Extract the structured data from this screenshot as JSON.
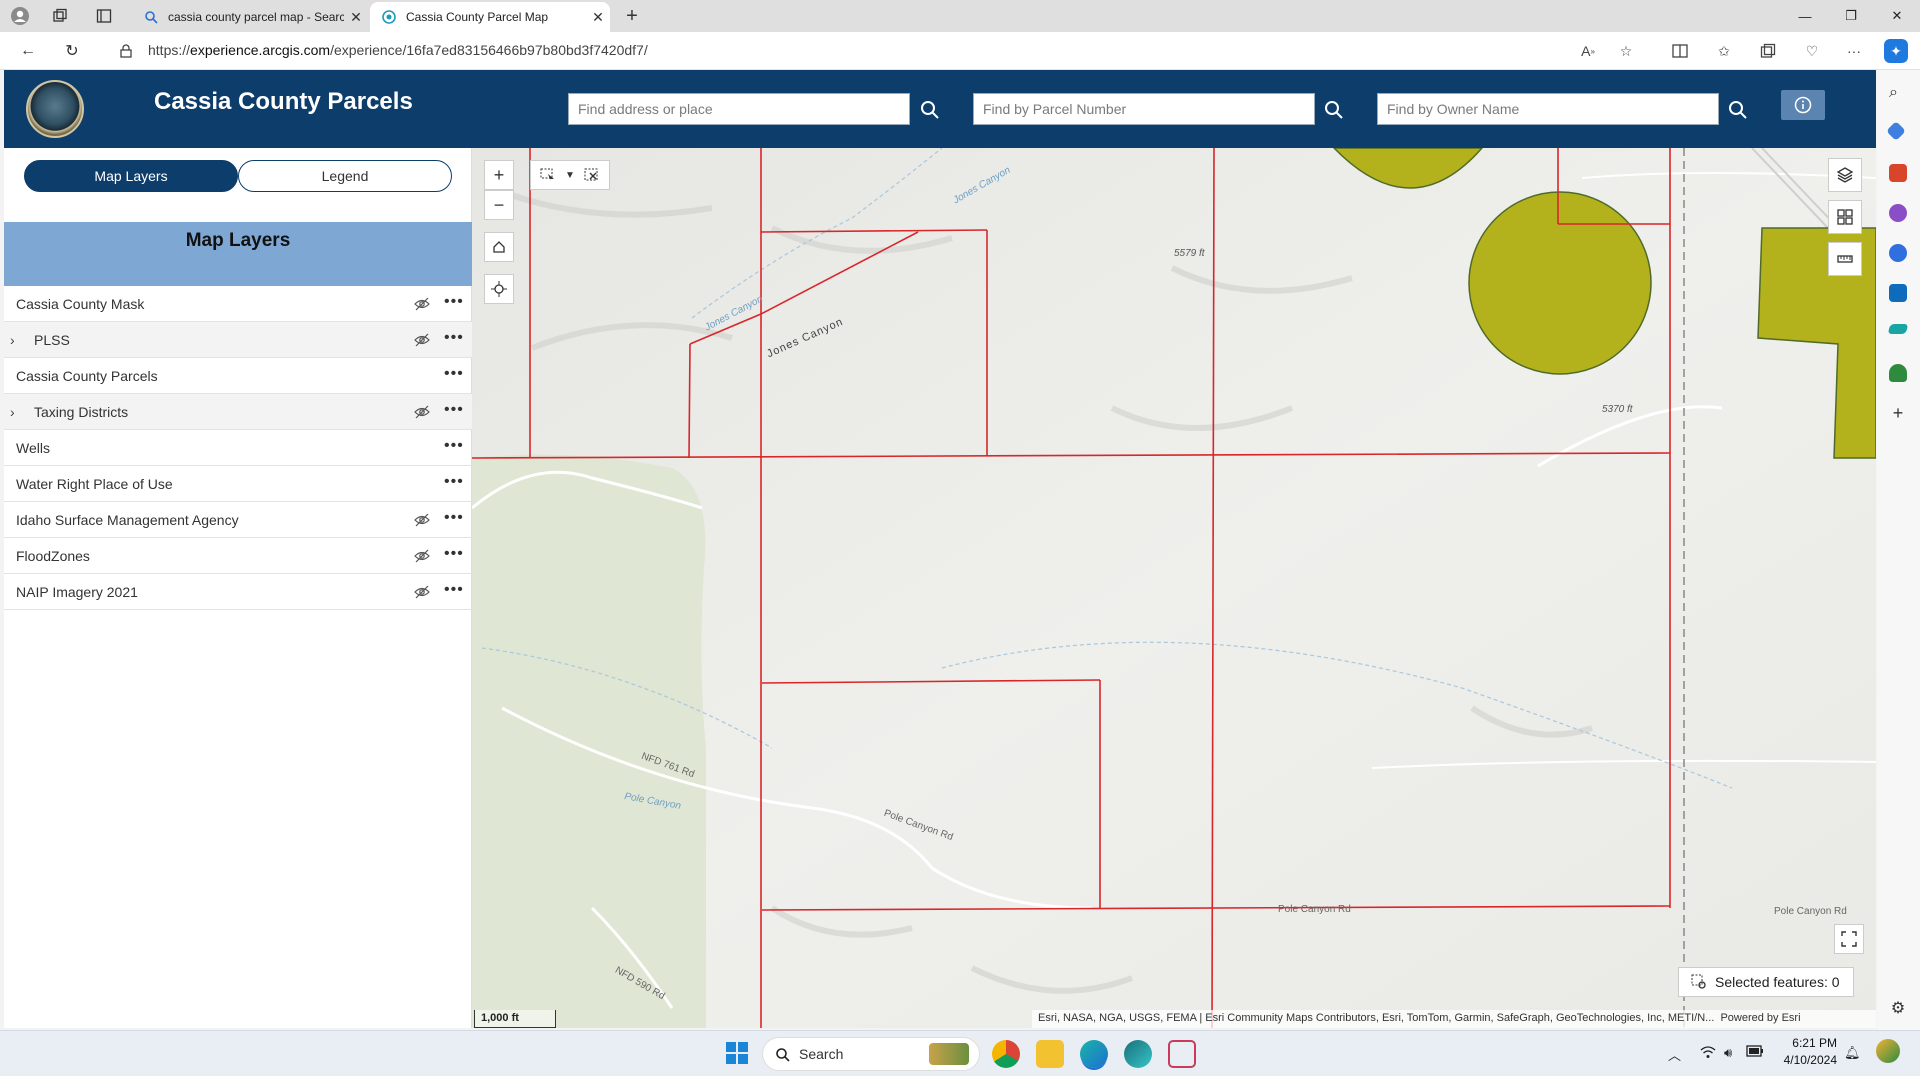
{
  "browser": {
    "tabs": [
      {
        "title": "cassia county parcel map - Search",
        "active": false
      },
      {
        "title": "Cassia County Parcel Map",
        "active": true
      }
    ],
    "url_prefix": "https://",
    "url_domain": "experience.arcgis.com",
    "url_path": "/experience/16fa7ed83156466b97b80bd3f7420df7/"
  },
  "header": {
    "title": "Cassia County Parcels",
    "search_address_placeholder": "Find address or place",
    "search_parcel_placeholder": "Find by Parcel Number",
    "search_owner_placeholder": "Find by Owner Name"
  },
  "panel": {
    "tab_layers": "Map Layers",
    "tab_legend": "Legend",
    "heading": "Map Layers",
    "layers": [
      {
        "name": "Cassia County Mask",
        "expandable": false,
        "visibility_icon": true
      },
      {
        "name": "PLSS",
        "expandable": true,
        "visibility_icon": true
      },
      {
        "name": "Cassia County Parcels",
        "expandable": false,
        "visibility_icon": false
      },
      {
        "name": "Taxing Districts",
        "expandable": true,
        "visibility_icon": true
      },
      {
        "name": "Wells",
        "expandable": false,
        "visibility_icon": false
      },
      {
        "name": "Water Right Place of Use",
        "expandable": false,
        "visibility_icon": false
      },
      {
        "name": "Idaho Surface Management Agency",
        "expandable": false,
        "visibility_icon": true
      },
      {
        "name": "FloodZones",
        "expandable": false,
        "visibility_icon": true
      },
      {
        "name": "NAIP Imagery 2021",
        "expandable": false,
        "visibility_icon": true
      }
    ]
  },
  "map": {
    "labels": {
      "jones_canyon_1": "Jones Canyon",
      "jones_canyon_2": "Jones Canyon",
      "jones_canyon_3": "Jones Canyon",
      "elev_1": "5579 ft",
      "elev_2": "5370 ft",
      "nfd_761": "NFD 761 Rd",
      "pole_canyon_stream": "Pole Canyon",
      "pole_canyon_rd_1": "Pole Canyon Rd",
      "pole_canyon_rd_2": "Pole Canyon Rd",
      "pole_canyon_rd_3": "Pole Canyon Rd",
      "nfd_590": "NFD 590 Rd"
    },
    "scale": "1,000 ft",
    "selected_features": "Selected features: 0",
    "attribution": "Esri, NASA, NGA, USGS, FEMA | Esri Community Maps Contributors, Esri, TomTom, Garmin, SafeGraph, GeoTechnologies, Inc, METI/N...",
    "powered_by": "Powered by Esri",
    "parcel_color": "#d9262b",
    "ag_color": "#b3b21c"
  },
  "taskbar": {
    "search_label": "Search",
    "time": "6:21 PM",
    "date": "4/10/2024"
  }
}
